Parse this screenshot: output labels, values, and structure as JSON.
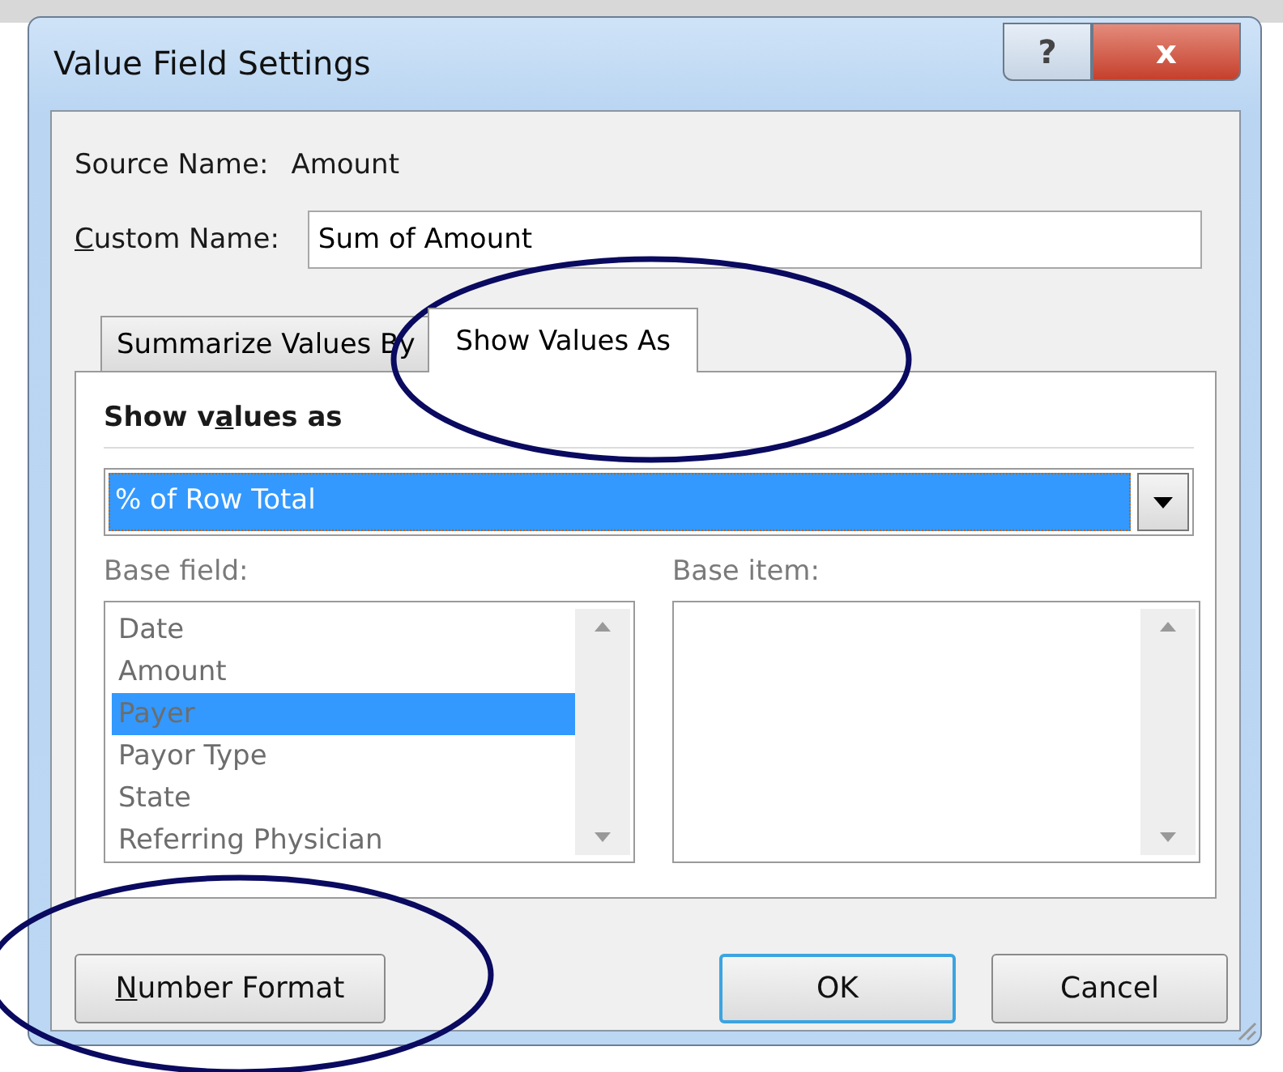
{
  "window": {
    "title": "Value Field Settings",
    "help_button": "?",
    "close_button": "x"
  },
  "source_name": {
    "label": "Source Name:",
    "value": "Amount"
  },
  "custom_name": {
    "label": "Custom Name:",
    "value": "Sum of Amount"
  },
  "tabs": [
    {
      "label": "Summarize Values By",
      "selected": false
    },
    {
      "label": "Show Values As",
      "selected": true
    }
  ],
  "show_values_as": {
    "heading": "Show values as",
    "value": "% of Row Total"
  },
  "base_field": {
    "label": "Base field:",
    "items": [
      {
        "label": "Date",
        "selected": false
      },
      {
        "label": "Amount",
        "selected": false
      },
      {
        "label": "Payer",
        "selected": true
      },
      {
        "label": "Payor Type",
        "selected": false
      },
      {
        "label": "State",
        "selected": false
      },
      {
        "label": "Referring Physician",
        "selected": false
      }
    ]
  },
  "base_item": {
    "label": "Base item:"
  },
  "buttons": [
    {
      "label": "Number Format",
      "kind": "left",
      "default": false
    },
    {
      "label": "OK",
      "kind": "right",
      "default": true
    },
    {
      "label": "Cancel",
      "kind": "right",
      "default": false
    }
  ]
}
